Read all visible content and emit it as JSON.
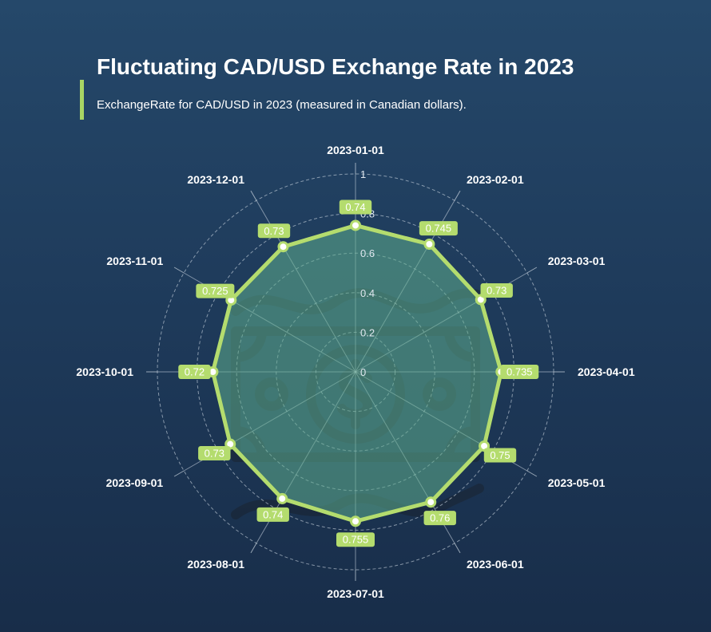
{
  "header": {
    "title": "Fluctuating CAD/USD Exchange Rate in 2023",
    "subtitle": "ExchangeRate for CAD/USD in 2023 (measured in Canadian dollars)."
  },
  "colors": {
    "accent": "#a8d564",
    "series_line": "#b4dc6e",
    "series_fill": "#5fae8e",
    "label_bg": "#b4dc6e",
    "grid": "#cfd8e3"
  },
  "icons": {
    "background": "money-bill-icon"
  },
  "chart_data": {
    "type": "radar",
    "title": "Fluctuating CAD/USD Exchange Rate in 2023",
    "subtitle": "ExchangeRate for CAD/USD in 2023 (measured in Canadian dollars).",
    "categories": [
      "2023-01-01",
      "2023-02-01",
      "2023-03-01",
      "2023-04-01",
      "2023-05-01",
      "2023-06-01",
      "2023-07-01",
      "2023-08-01",
      "2023-09-01",
      "2023-10-01",
      "2023-11-01",
      "2023-12-01"
    ],
    "series": [
      {
        "values": [
          0.74,
          0.745,
          0.73,
          0.735,
          0.75,
          0.76,
          0.755,
          0.74,
          0.73,
          0.72,
          0.725,
          0.73
        ]
      }
    ],
    "radial_range": [
      0,
      1
    ],
    "radial_ticks": [
      "0",
      "0.2",
      "0.4",
      "0.6",
      "0.8",
      "1"
    ],
    "grid": true,
    "legend": "none"
  }
}
